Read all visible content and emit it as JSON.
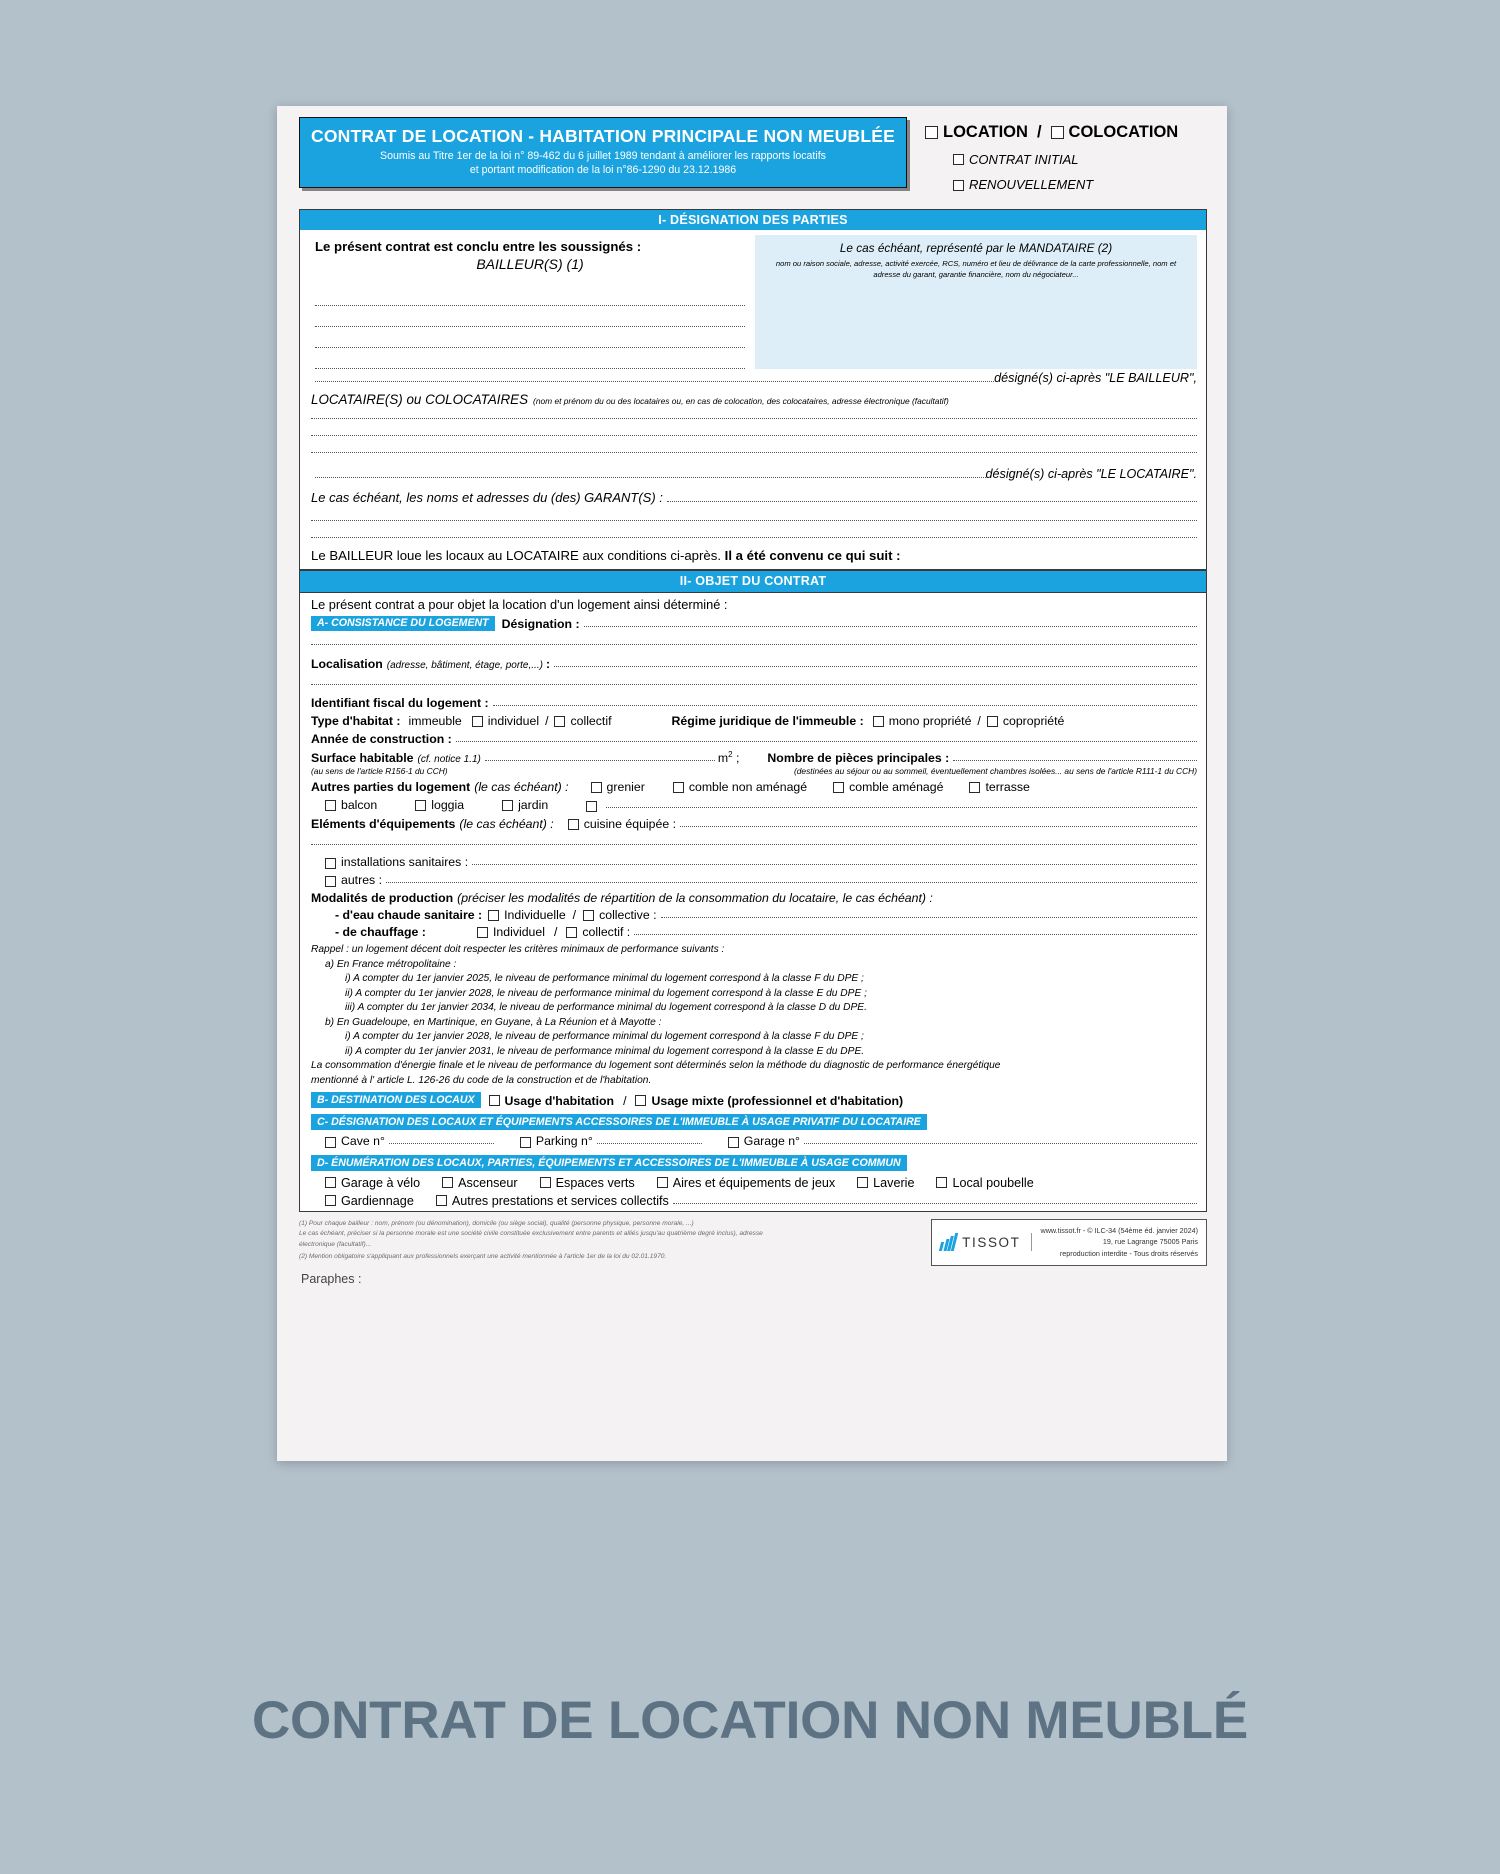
{
  "caption": "CONTRAT DE LOCATION NON MEUBLÉ",
  "colors": {
    "accent": "#1ba3e0",
    "page_bg": "#b3c1cb",
    "mandataire_bg": "#ddeef9",
    "caption": "#5d7283"
  },
  "header": {
    "title": "CONTRAT DE LOCATION  -  HABITATION PRINCIPALE NON MEUBLÉE",
    "subtitle_line1": "Soumis au Titre 1er de la loi n° 89-462 du 6 juillet 1989 tendant à améliorer les rapports locatifs",
    "subtitle_line2": "et portant modification de la loi n°86-1290 du 23.12.1986",
    "option_location": "LOCATION",
    "separator": "/",
    "option_colocation": "COLOCATION",
    "option_contrat_initial": "CONTRAT INITIAL",
    "option_renouvellement": "RENOUVELLEMENT"
  },
  "section_1": {
    "band": "I- DÉSIGNATION DES PARTIES",
    "intro": "Le présent contrat est conclu entre les soussignés :",
    "bailleur_label": "BAILLEUR(S) (1)",
    "mandataire_title": "Le cas échéant, représenté par le MANDATAIRE (2)",
    "mandataire_note": "nom ou raison sociale, adresse, activité exercée, RCS, numéro et lieu de délivrance de la carte professionnelle, nom et adresse du garant, garantie financière, nom du négociateur...",
    "designe_bailleur": "désigné(s) ci-après \"LE BAILLEUR\",",
    "locataire_label": "LOCATAIRE(S) ou COLOCATAIRES",
    "locataire_note": "(nom et prénom du ou des locataires ou, en cas de colocation, des colocataires, adresse électronique (facultatif)",
    "designe_locataire": "désigné(s) ci-après \"LE LOCATAIRE\".",
    "garants_label": "Le cas échéant, les noms et adresses du (des) GARANT(S) :",
    "closing_normal": "Le BAILLEUR loue les locaux au LOCATAIRE aux conditions ci-après.",
    "closing_bold": "Il a été convenu ce qui suit :"
  },
  "section_2": {
    "band": "II- OBJET DU CONTRAT",
    "intro": "Le présent contrat a pour objet la location d'un logement ainsi déterminé :",
    "a": {
      "tag": "A- CONSISTANCE DU LOGEMENT",
      "designation_label": "Désignation :",
      "localisation_label": "Localisation",
      "localisation_note": "(adresse, bâtiment, étage, porte,...)",
      "identifiant_label": "Identifiant fiscal du logement :",
      "type_habitat_label": "Type d'habitat :",
      "type_habitat_immeuble": "immeuble",
      "type_habitat_individuel": "individuel",
      "type_habitat_slash": "/",
      "type_habitat_collectif": "collectif",
      "regime_label": "Régime juridique de l'immeuble :",
      "regime_mono": "mono propriété",
      "regime_slash": "/",
      "regime_copro": "copropriété",
      "annee_label": "Année de construction :",
      "surface_label": "Surface habitable",
      "surface_note": "(cf. notice 1.1)",
      "surface_unit": "m",
      "surface_unit_exp": "2",
      "surface_unit_semi": ";",
      "surface_footnote": "(au sens de l'article R156-1 du CCH)",
      "pieces_label": "Nombre de pièces principales :",
      "pieces_footnote": "(destinées au séjour ou au sommeil, éventuellement chambres isolées... au sens de l'article R111-1 du CCH)",
      "autres_parties_label": "Autres parties du logement",
      "autres_parties_note": "(le cas échéant) :",
      "autres_parties_options": [
        "grenier",
        "comble non aménagé",
        "comble aménagé",
        "terrasse"
      ],
      "autres_parties_options2": [
        "balcon",
        "loggia",
        "jardin"
      ],
      "elements_label": "Eléments d'équipements",
      "elements_note": "(le cas échéant) :",
      "elements_cuisine": "cuisine équipée :",
      "installations_label": "installations sanitaires :",
      "autres_label": "autres :",
      "modalites_label": "Modalités de production",
      "modalites_note": "(préciser les modalités de répartition de la consommation du locataire, le cas échéant) :",
      "ecs_label": "- d'eau chaude sanitaire :",
      "ecs_individuelle": "Individuelle",
      "ecs_slash": "/",
      "ecs_collective": "collective :",
      "chauffage_label": "- de chauffage :",
      "chauffage_individuel": "Individuel",
      "chauffage_slash": "/",
      "chauffage_collectif": "collectif :",
      "rappel_intro": "Rappel : un logement décent doit respecter les critères minimaux de performance suivants :",
      "rappel_a": "a) En France métropolitaine :",
      "rappel_a_i": "i) A compter du 1er janvier 2025, le niveau de performance minimal du logement correspond à la classe F du DPE ;",
      "rappel_a_ii": "ii) A compter du 1er janvier 2028, le niveau de performance minimal du logement correspond à la classe E du DPE ;",
      "rappel_a_iii": "iii) A compter du 1er janvier 2034, le niveau de performance minimal du logement correspond à la classe D du DPE.",
      "rappel_b": "b) En Guadeloupe, en Martinique, en Guyane, à La Réunion et à Mayotte :",
      "rappel_b_i": "i) A compter du 1er janvier 2028, le niveau de performance minimal du logement correspond à la classe F du DPE ;",
      "rappel_b_ii": "ii) A compter du 1er janvier 2031, le niveau de performance minimal du logement correspond à la classe E du DPE.",
      "rappel_conso_1": "La consommation d'énergie finale et le niveau de performance du logement sont déterminés selon la méthode du diagnostic de performance énergétique",
      "rappel_conso_2": "mentionné à l' article L. 126-26 du code de la construction et de l'habitation."
    },
    "b": {
      "tag": "B-  DESTINATION DES LOCAUX",
      "usage_habitation": "Usage d'habitation",
      "slash": "/",
      "usage_mixte": "Usage mixte (professionnel et d'habitation)"
    },
    "c": {
      "tag_normal": "C-  DÉSIGNATION DES LOCAUX ET ÉQUIPEMENTS ACCESSOIRES DE L'IMMEUBLE ",
      "tag_light": "À USAGE PRIVATIF ",
      "tag_bold": "DU LOCATAIRE",
      "cave": "Cave n°",
      "parking": "Parking n°",
      "garage": "Garage n°"
    },
    "d": {
      "tag_normal": "D-  ÉNUMÉRATION DES LOCAUX, PARTIES, ÉQUIPEMENTS ET ACCESSOIRES DE L'IMMEUBLE ",
      "tag_light": "À USAGE COMMUN",
      "options_row1": [
        "Garage à vélo",
        "Ascenseur",
        "Espaces verts",
        "Aires et équipements de jeux",
        "Laverie",
        "Local poubelle"
      ],
      "options_row2": [
        "Gardiennage",
        "Autres prestations et services collectifs"
      ]
    }
  },
  "footnotes": {
    "note1": "(1) Pour chaque bailleur : nom, prénom (ou dénomination), domicile (ou siège social), qualité (personne physique, personne morale, ...)",
    "note1b": "Le cas échéant, préciser si la personne morale est une société civile constituée exclusivement entre parents et alliés jusqu'au quatrième degré inclus), adresse électronique (facultatif)...",
    "note2": "(2) Mention obligatoire s'appliquant aux professionnels exerçant une activité mentionnée à l'article 1er de la loi du 02.01.1970."
  },
  "footer": {
    "brand": "TISSOT",
    "line1": "www.tissot.fr - © ILC-34 (54ème éd. janvier 2024)",
    "line2": "19, rue Lagrange 75005 Paris",
    "line3": "reproduction interdite  -  Tous droits réservés",
    "paraphes": "Paraphes :"
  }
}
